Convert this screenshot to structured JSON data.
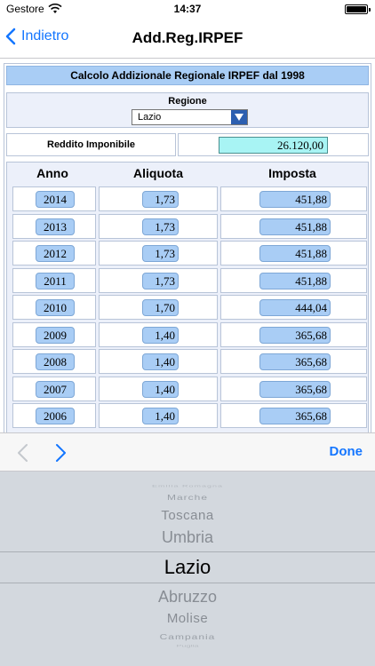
{
  "status_bar": {
    "carrier": "Gestore",
    "time": "14:37"
  },
  "nav": {
    "back_label": "Indietro",
    "title": "Add.Reg.IRPEF"
  },
  "form": {
    "banner": "Calcolo Addizionale Regionale IRPEF dal 1998",
    "region_label": "Regione",
    "region_value": "Lazio",
    "income_label": "Reddito Imponibile",
    "income_value": "26.120,00"
  },
  "table": {
    "headers": {
      "year": "Anno",
      "rate": "Aliquota",
      "tax": "Imposta"
    },
    "rows": [
      {
        "year": "2014",
        "rate": "1,73",
        "tax": "451,88"
      },
      {
        "year": "2013",
        "rate": "1,73",
        "tax": "451,88"
      },
      {
        "year": "2012",
        "rate": "1,73",
        "tax": "451,88"
      },
      {
        "year": "2011",
        "rate": "1,73",
        "tax": "451,88"
      },
      {
        "year": "2010",
        "rate": "1,70",
        "tax": "444,04"
      },
      {
        "year": "2009",
        "rate": "1,40",
        "tax": "365,68"
      },
      {
        "year": "2008",
        "rate": "1,40",
        "tax": "365,68"
      },
      {
        "year": "2007",
        "rate": "1,40",
        "tax": "365,68"
      },
      {
        "year": "2006",
        "rate": "1,40",
        "tax": "365,68"
      }
    ]
  },
  "toolbar": {
    "done_label": "Done"
  },
  "picker": {
    "items": [
      "Emilia Romagna",
      "Marche",
      "Toscana",
      "Umbria",
      "Lazio",
      "Abruzzo",
      "Molise",
      "Campania",
      "Puglia"
    ],
    "selected": "Lazio"
  },
  "colors": {
    "accent": "#1476ff",
    "pill": "#a9cdf5",
    "input": "#a8f4f4",
    "picker_bg": "#d3d8de"
  },
  "icons": [
    "wifi-icon",
    "battery-icon",
    "back-chevron-icon",
    "dropdown-arrow-icon",
    "previous-field-icon",
    "next-field-icon"
  ]
}
